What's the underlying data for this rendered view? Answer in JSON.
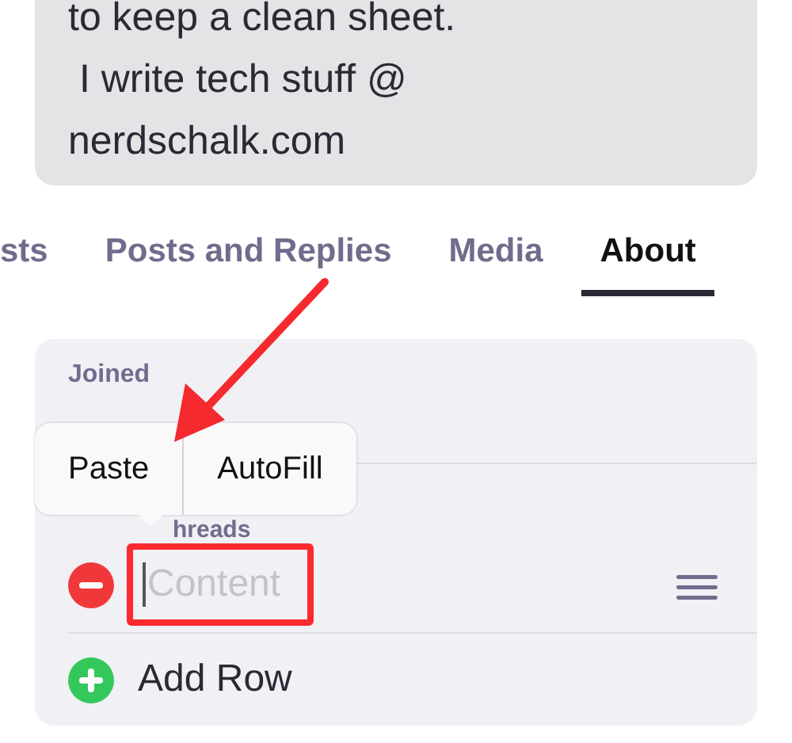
{
  "bio": {
    "lines": [
      "to keep a clean sheet.",
      " I write tech stuff @",
      "nerdschalk.com"
    ]
  },
  "tabs": [
    {
      "label": "sts",
      "selected": false
    },
    {
      "label": "Posts and Replies",
      "selected": false
    },
    {
      "label": "Media",
      "selected": false
    },
    {
      "label": "About",
      "selected": true
    }
  ],
  "about": {
    "joined_label": "Joined",
    "rows": [
      {
        "kind": "text-field",
        "label": "hreads",
        "placeholder": "Content",
        "focused": true,
        "highlighted": true
      }
    ],
    "add_row": "Add Row"
  },
  "edit_menu": {
    "items": [
      "Paste",
      "AutoFill"
    ]
  }
}
